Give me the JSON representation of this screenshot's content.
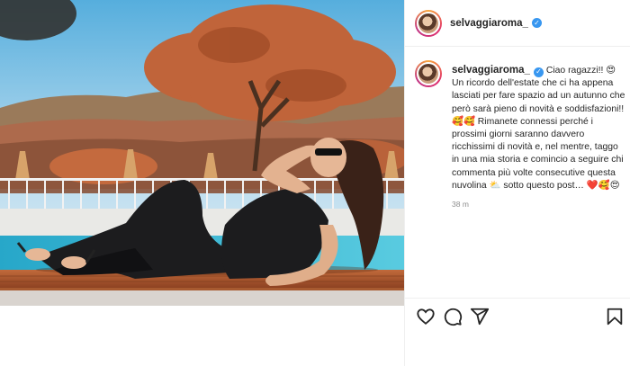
{
  "post": {
    "username": "selvaggiaroma_",
    "verified_icon": "verified-badge-icon",
    "photo_alt": "Woman in black jumpsuit lying on pool deck",
    "caption_text": "Ciao ragazzi!! 😍 Un ricordo dell'estate che ci ha appena lasciati per fare spazio ad un autunno che però sarà pieno di novità e soddisfazioni!! 🥰🥰 Rimanete connessi perché i prossimi giorni saranno davvero ricchissimi di novità e, nel mentre, taggo in una mia storia e comincio a seguire chi commenta più volte consecutive questa nuvolina ⛅ sotto questo post… ❤️🥰😍",
    "time_ago": "38 m"
  },
  "actions": {
    "like_icon": "heart-icon",
    "comment_icon": "comment-icon",
    "share_icon": "share-icon",
    "save_icon": "bookmark-icon"
  }
}
